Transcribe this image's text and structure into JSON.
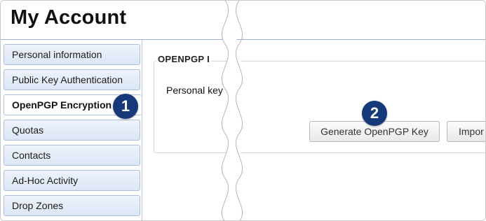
{
  "header": {
    "title": "My Account"
  },
  "sidebar": {
    "items": [
      {
        "label": "Personal information"
      },
      {
        "label": "Public Key Authentication"
      },
      {
        "label": "OpenPGP Encryption"
      },
      {
        "label": "Quotas"
      },
      {
        "label": "Contacts"
      },
      {
        "label": "Ad-Hoc Activity"
      },
      {
        "label": "Drop Zones"
      }
    ]
  },
  "main": {
    "section_title": "OPENPGP I",
    "personal_key_label": "Personal key",
    "generate_button": "Generate OpenPGP Key",
    "import_button": "Impor"
  },
  "callouts": {
    "one": "1",
    "two": "2"
  }
}
